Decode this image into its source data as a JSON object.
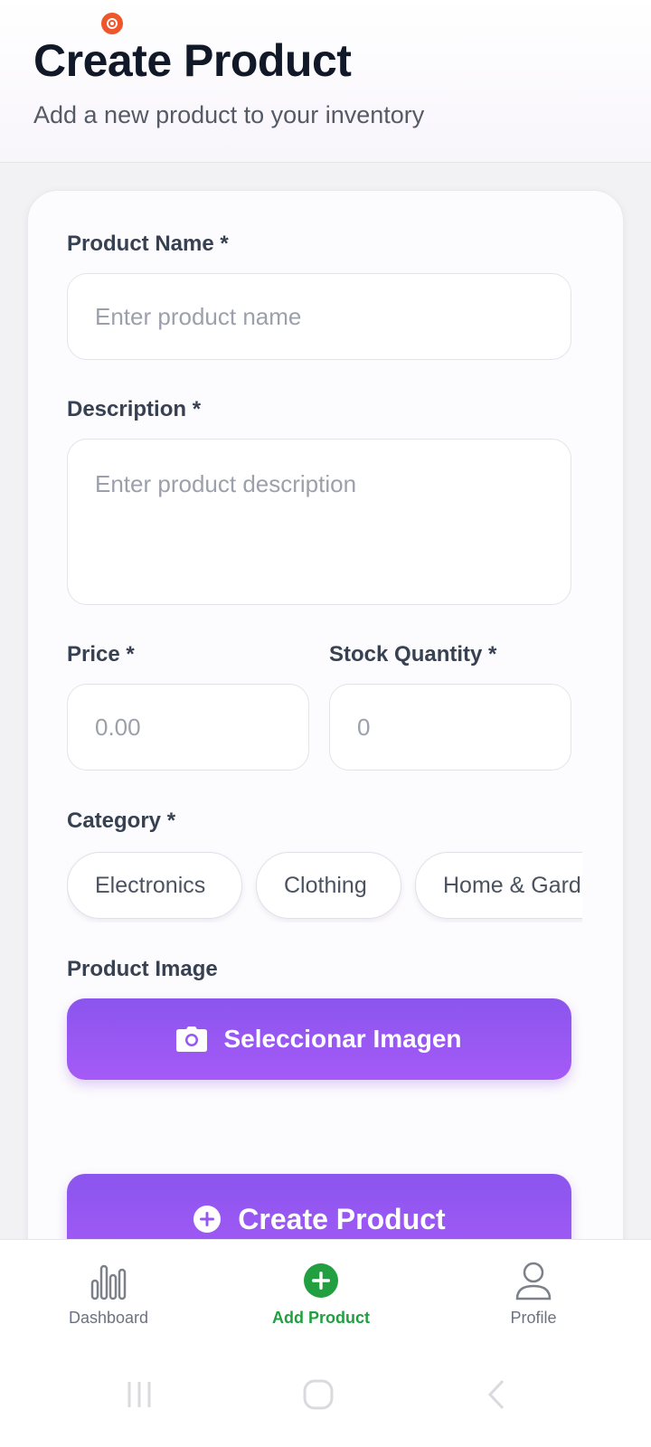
{
  "header": {
    "title": "Create Product",
    "subtitle": "Add a new product to your inventory"
  },
  "form": {
    "name": {
      "label": "Product Name *",
      "placeholder": "Enter product name"
    },
    "description": {
      "label": "Description *",
      "placeholder": "Enter product description"
    },
    "price": {
      "label": "Price *",
      "placeholder": "0.00"
    },
    "stock": {
      "label": "Stock Quantity *",
      "placeholder": "0"
    },
    "category": {
      "label": "Category *",
      "options": [
        "Electronics",
        "Clothing",
        "Home & Garden"
      ]
    },
    "image": {
      "label": "Product Image",
      "button_label": "Seleccionar Imagen"
    },
    "submit_label": "Create Product"
  },
  "nav": {
    "items": [
      {
        "label": "Dashboard",
        "icon": "bar-chart-icon"
      },
      {
        "label": "Add Product",
        "icon": "plus-circle-icon",
        "active": true
      },
      {
        "label": "Profile",
        "icon": "user-icon"
      }
    ]
  },
  "colors": {
    "accent": "#9b58f3",
    "active_nav": "#22a041"
  }
}
